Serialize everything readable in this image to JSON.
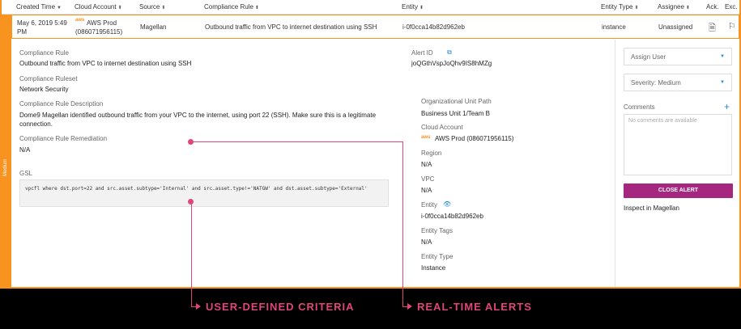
{
  "table": {
    "headers": {
      "created_time": "Created Time",
      "cloud_account": "Cloud Account",
      "source": "Source",
      "compliance_rule": "Compliance Rule",
      "entity": "Entity",
      "entity_type": "Entity Type",
      "assignee": "Assignee",
      "ack": "Ack.",
      "exc": "Exc."
    },
    "row": {
      "created_time_line1": "May 6, 2019 5:49",
      "created_time_line2": "PM",
      "aws_badge": "aws",
      "cloud_account_line1": "AWS Prod",
      "cloud_account_line2": "(086071956115)",
      "source": "Magellan",
      "compliance_rule": "Outbound traffic from VPC to internet destination using SSH",
      "entity": "i-0f0cca14b82d962eb",
      "entity_type": "instance",
      "assignee": "Unassigned"
    }
  },
  "severity_bar": "Medium",
  "details": {
    "compliance_rule_label": "Compliance Rule",
    "compliance_rule_value": "Outbound traffic from VPC to internet destination using SSH",
    "ruleset_label": "Compliance Ruleset",
    "ruleset_value": "Network Security",
    "description_label": "Compliance Rule Description",
    "description_value": "Dome9 Magellan identified outbound traffic from your VPC to the internet, using port 22 (SSH). Make sure this is a legitimate connection.",
    "remediation_label": "Compliance Rule Remediation",
    "remediation_value": "N/A",
    "gsl_label": "GSL",
    "gsl_value": "vpcfl where dst.port=22 and src.asset.subtype='Internal' and src.asset.type!='NATGW' and dst.asset.subtype='External'"
  },
  "meta": {
    "alert_id_label": "Alert ID",
    "alert_id_value": "joQGthVspJoQhv9IS8hMZg",
    "org_unit_label": "Organizational Unit Path",
    "org_unit_value": "Business Unit 1/Team B",
    "cloud_account_label": "Cloud Account",
    "cloud_account_value": "AWS Prod (086071956115)",
    "region_label": "Region",
    "region_value": "N/A",
    "vpc_label": "VPC",
    "vpc_value": "N/A",
    "entity_label": "Entity",
    "entity_value": "i-0f0cca14b82d962eb",
    "entity_tags_label": "Entity Tags",
    "entity_tags_value": "N/A",
    "entity_type_label": "Entity Type",
    "entity_type_value": "Instance"
  },
  "sidebar": {
    "assign_user": "Assign User",
    "severity": "Severity: Medium",
    "comments_label": "Comments",
    "comments_placeholder": "No comments are available",
    "close_alert": "CLOSE ALERT",
    "inspect_link": "Inspect in Magellan"
  },
  "annotations": {
    "left": "USER-DEFINED CRITERIA",
    "right": "REAL-TIME ALERTS"
  },
  "colors": {
    "accent_orange": "#f7931e",
    "link_blue": "#1f8dd6",
    "button_purple": "#a6277f",
    "annotation_pink": "#e0457b"
  }
}
